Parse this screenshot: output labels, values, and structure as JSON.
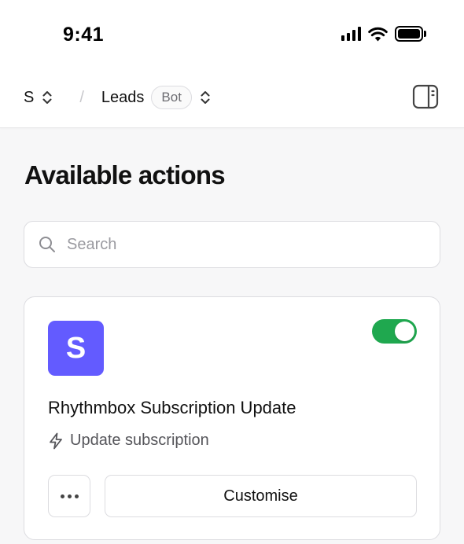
{
  "status_bar": {
    "time": "9:41",
    "icons": [
      "signal-icon",
      "wifi-icon",
      "battery-icon"
    ]
  },
  "header": {
    "workspace": "S",
    "separator": "/",
    "page": "Leads",
    "badge": "Bot",
    "icons": [
      "chevron-up-down-icon",
      "sidebar-panel-icon"
    ]
  },
  "title": "Available actions",
  "search": {
    "placeholder": "Search",
    "value": ""
  },
  "action_card": {
    "logo_letter": "S",
    "logo_color": "#635bff",
    "enabled": true,
    "toggle_color": "#1fa84f",
    "title": "Rhythmbox Subscription Update",
    "subtitle": "Update subscription",
    "subtitle_icon": "lightning-icon",
    "more_icon": "more-horizontal-icon",
    "customise_label": "Customise"
  }
}
